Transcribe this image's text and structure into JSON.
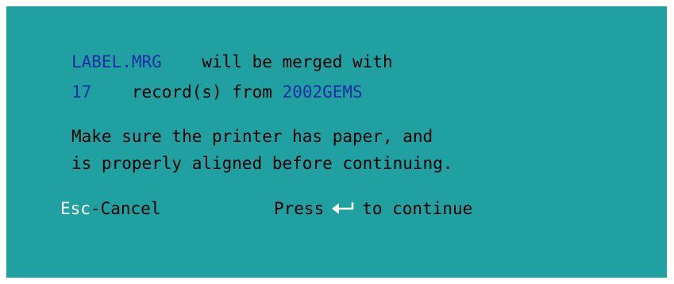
{
  "merge": {
    "target_file": "LABEL.MRG",
    "merged_with_text": "will be merged with",
    "record_count": "17",
    "records_from_text": "record(s) from",
    "source_db": "2002GEMS"
  },
  "instructions": {
    "line1": "Make sure the printer has paper, and",
    "line2": "is properly aligned before continuing."
  },
  "footer": {
    "esc_key": "Esc",
    "esc_action": "-Cancel",
    "press_label": "Press",
    "continue_label": "to continue",
    "enter_icon": "enter-key-icon"
  },
  "colors": {
    "background": "#20a0a0",
    "highlight": "#1a2fa6",
    "key": "#ffffff",
    "text": "#000000"
  }
}
